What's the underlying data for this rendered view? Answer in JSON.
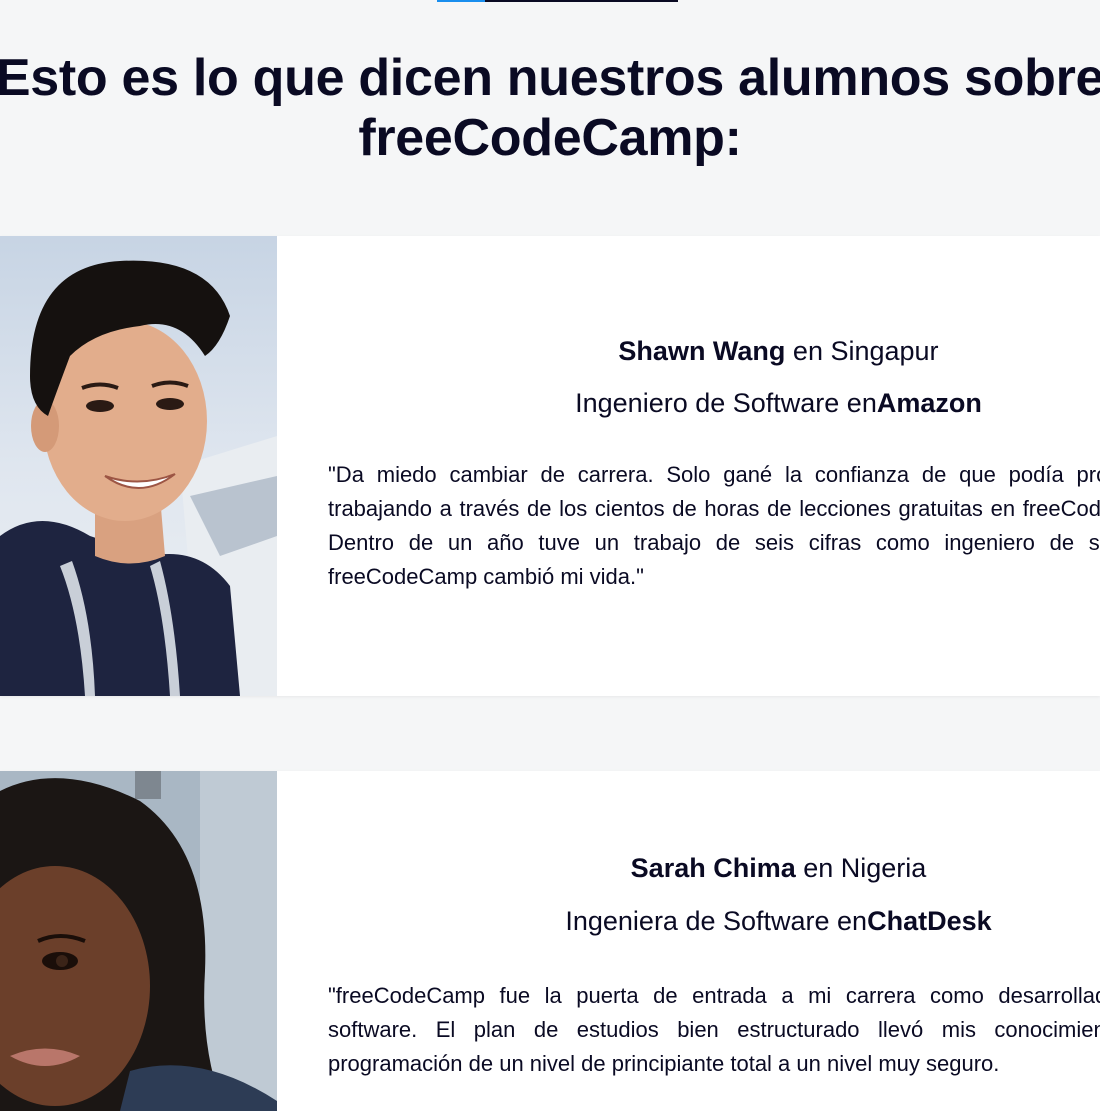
{
  "heading": "Esto es lo que dicen nuestros alumnos sobre freeCodeCamp:",
  "testimonials": [
    {
      "name": "Shawn Wang",
      "location_prefix": " en ",
      "location": "Singapur",
      "role": "Ingeniero de Software en",
      "company": "Amazon",
      "quote": "\"Da miedo cambiar de carrera. Solo gané la confianza de que podía programar trabajando a través de los cientos de horas de lecciones gratuitas en freeCodeCamp. Dentro de un año tuve un trabajo de seis cifras como ingeniero de software. freeCodeCamp cambió mi vida.\""
    },
    {
      "name": "Sarah Chima",
      "location_prefix": " en ",
      "location": "Nigeria",
      "role": "Ingeniera de Software en",
      "company": "ChatDesk",
      "quote": "\"freeCodeCamp fue la puerta de entrada a mi carrera como desarrolladora de software. El plan de estudios bien estructurado llevó mis conocimientos de programación de un nivel de principiante total a un nivel muy seguro."
    }
  ],
  "colors": {
    "background": "#f5f6f7",
    "card": "#ffffff",
    "text": "#0a0a23",
    "accent": "#198eee"
  }
}
